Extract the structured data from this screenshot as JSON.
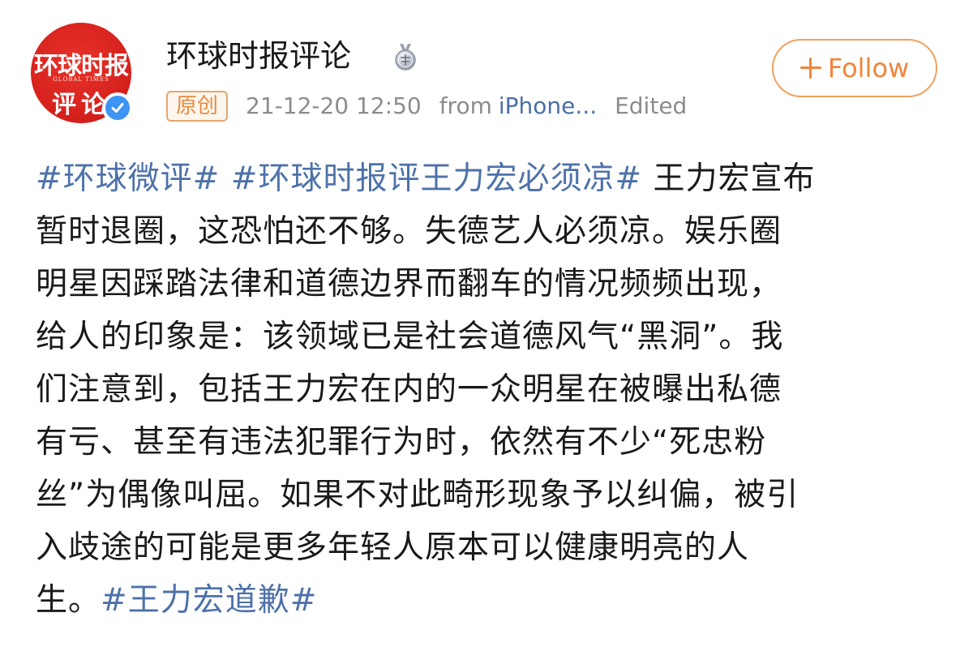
{
  "header": {
    "avatar": {
      "brand_text": "环球时报",
      "brand_sub": "GLOBAL TIMES",
      "seal_text": "评论"
    },
    "user_name": "环球时报评论",
    "medal_icon": "medal-icon",
    "verified_icon": "verified-check-icon",
    "meta": {
      "original_tag": "原创",
      "time": "21-12-20 12:50",
      "from_label": "from",
      "device": "iPhone...",
      "edited": "Edited"
    },
    "follow_label": "Follow"
  },
  "post": {
    "lines": [
      [
        {
          "text": "#环球微评#",
          "hashtag": true
        },
        {
          "text": " ",
          "hashtag": false
        },
        {
          "text": "#环球时报评王力宏必须凉#",
          "hashtag": true
        },
        {
          "text": " 王力宏宣布",
          "hashtag": false
        }
      ],
      [
        {
          "text": "暂时退圈，这恐怕还不够。失德艺人必须凉。娱乐圈",
          "hashtag": false
        }
      ],
      [
        {
          "text": "明星因踩踏法律和道德边界而翻车的情况频频出现，",
          "hashtag": false
        }
      ],
      [
        {
          "text": "给人的印象是：该领域已是社会道德风气“黑洞”。我",
          "hashtag": false
        }
      ],
      [
        {
          "text": "们注意到，包括王力宏在内的一众明星在被曝出私德",
          "hashtag": false
        }
      ],
      [
        {
          "text": "有亏、甚至有违法犯罪行为时，依然有不少“死忠粉",
          "hashtag": false
        }
      ],
      [
        {
          "text": "丝”为偶像叫屈。如果不对此畸形现象予以纠偏，被引",
          "hashtag": false
        }
      ],
      [
        {
          "text": "入歧途的可能是更多年轻人原本可以健康明亮的人",
          "hashtag": false
        }
      ],
      [
        {
          "text": "生。",
          "hashtag": false
        },
        {
          "text": "#王力宏道歉#",
          "hashtag": true
        }
      ]
    ]
  },
  "colors": {
    "hashtag": "#4e72a9",
    "follow_accent": "#f0853a",
    "avatar_red": "#d4201c",
    "verified_blue": "#3d94f2",
    "meta_gray": "#8c8c8c"
  }
}
